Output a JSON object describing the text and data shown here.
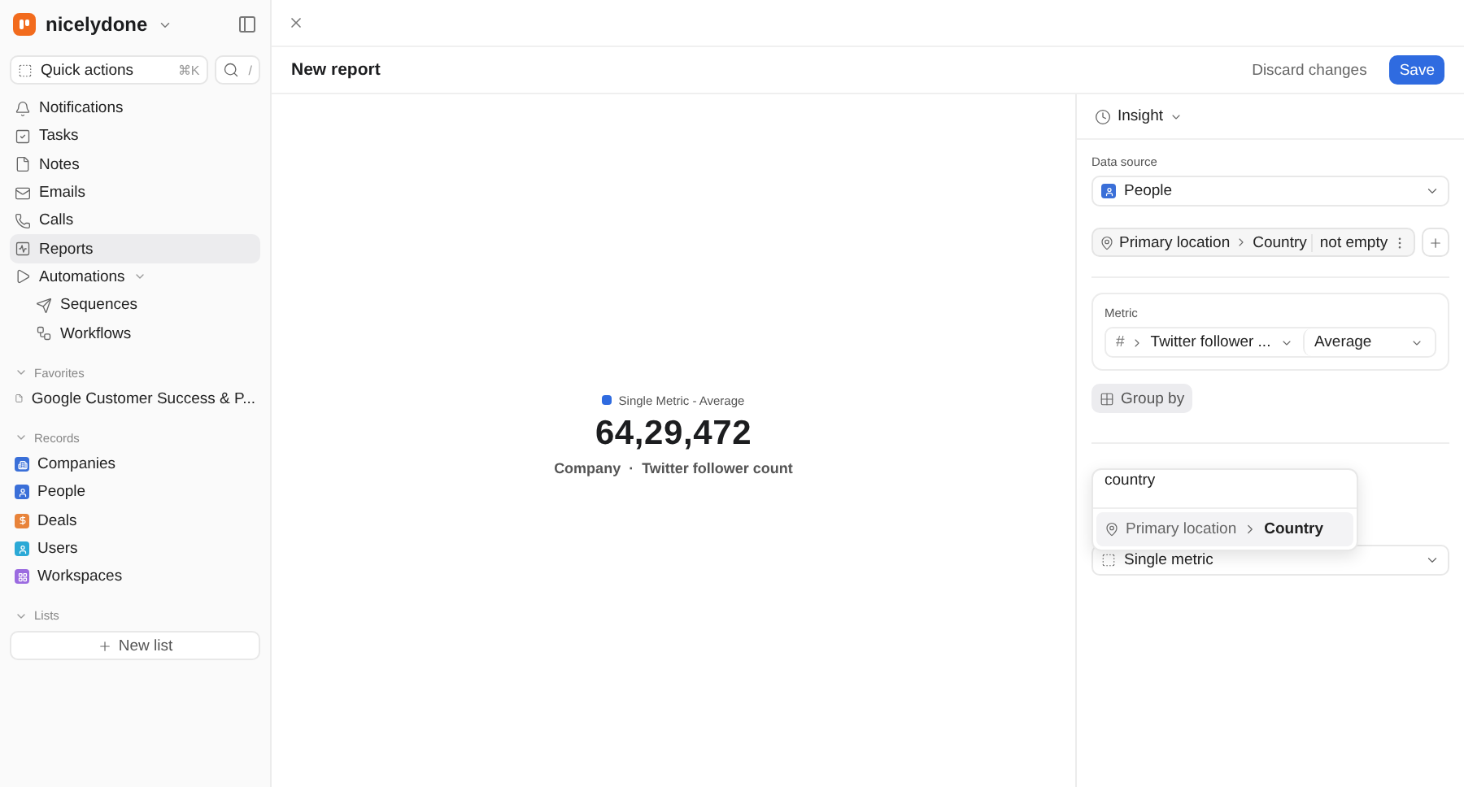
{
  "workspace": {
    "name": "nicelydone"
  },
  "quick_actions": {
    "label": "Quick actions",
    "shortcut": "⌘K",
    "search_shortcut": "/"
  },
  "nav": [
    {
      "label": "Notifications",
      "selected": false
    },
    {
      "label": "Tasks",
      "selected": false
    },
    {
      "label": "Notes",
      "selected": false
    },
    {
      "label": "Emails",
      "selected": false
    },
    {
      "label": "Calls",
      "selected": false
    },
    {
      "label": "Reports",
      "selected": true
    }
  ],
  "automations": {
    "label": "Automations",
    "expanded": true,
    "children": [
      {
        "label": "Sequences"
      },
      {
        "label": "Workflows"
      }
    ]
  },
  "favorites": {
    "title": "Favorites",
    "expanded": true,
    "items": [
      {
        "label": "Google Customer Success & P..."
      }
    ]
  },
  "records": {
    "title": "Records",
    "expanded": true,
    "items": [
      {
        "label": "Companies",
        "color": "#3a6fd8"
      },
      {
        "label": "People",
        "color": "#3a6fd8"
      },
      {
        "label": "Deals",
        "color": "#e8833a"
      },
      {
        "label": "Users",
        "color": "#2ba9d6"
      },
      {
        "label": "Workspaces",
        "color": "#9b6be0"
      }
    ]
  },
  "lists": {
    "title": "Lists",
    "expanded": true,
    "new_list": "New list"
  },
  "header": {
    "title": "New report",
    "discard": "Discard changes",
    "save": "Save"
  },
  "metric_view": {
    "legend": "Single Metric - Average",
    "value": "64,29,472",
    "subtitle": [
      "Company",
      "Twitter follower count"
    ],
    "separator": "·"
  },
  "panel": {
    "type": "Insight",
    "data_source_label": "Data source",
    "data_source": "People",
    "filter": {
      "field": "Primary location",
      "subfield": "Country",
      "condition": "not empty"
    },
    "metric": {
      "label": "Metric",
      "symbol": "#",
      "field": "Twitter follower ...",
      "aggregate": "Average"
    },
    "group_by": "Group by",
    "dropdown": {
      "query": "country",
      "options": [
        {
          "field": "Primary location",
          "subfield": "Country",
          "selected": true
        }
      ]
    },
    "visualization": "Single metric"
  }
}
